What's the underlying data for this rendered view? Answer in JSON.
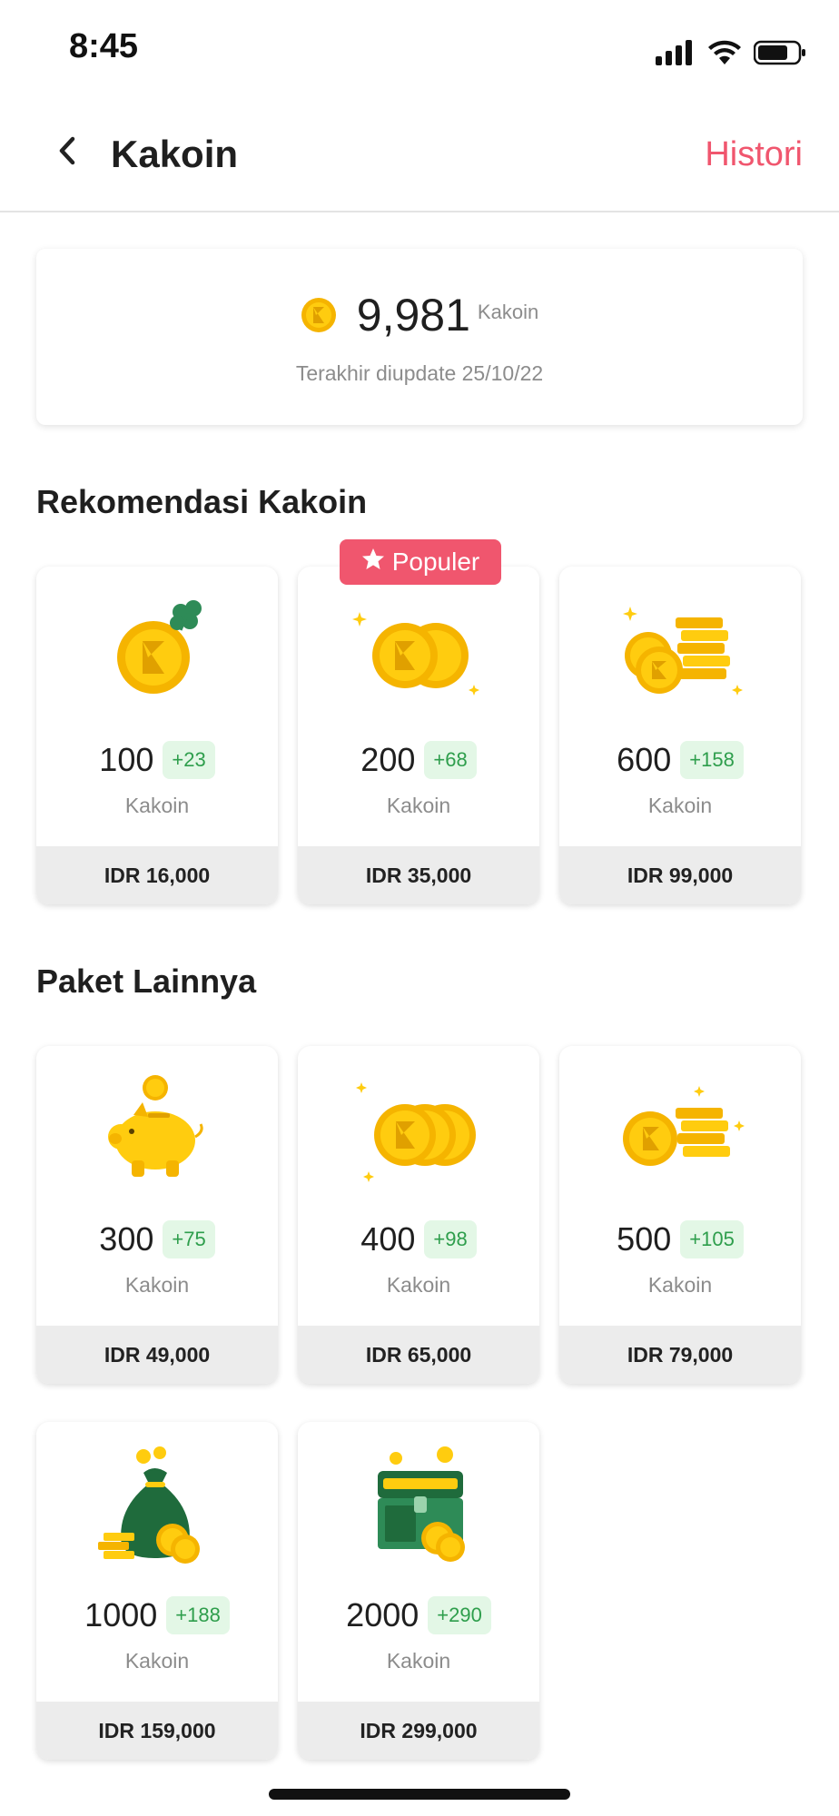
{
  "status_bar": {
    "time": "8:45"
  },
  "header": {
    "title": "Kakoin",
    "histori_label": "Histori"
  },
  "balance": {
    "amount": "9,981",
    "unit": "Kakoin",
    "updated_text": "Terakhir diupdate 25/10/22"
  },
  "sections": {
    "recommended_title": "Rekomendasi Kakoin",
    "others_title": "Paket Lainnya"
  },
  "badge": {
    "populer": "Populer"
  },
  "packages": [
    {
      "amount": "100",
      "bonus": "+23",
      "unit": "Kakoin",
      "price": "IDR 16,000"
    },
    {
      "amount": "200",
      "bonus": "+68",
      "unit": "Kakoin",
      "price": "IDR 35,000"
    },
    {
      "amount": "600",
      "bonus": "+158",
      "unit": "Kakoin",
      "price": "IDR 99,000"
    },
    {
      "amount": "300",
      "bonus": "+75",
      "unit": "Kakoin",
      "price": "IDR 49,000"
    },
    {
      "amount": "400",
      "bonus": "+98",
      "unit": "Kakoin",
      "price": "IDR 65,000"
    },
    {
      "amount": "500",
      "bonus": "+105",
      "unit": "Kakoin",
      "price": "IDR 79,000"
    },
    {
      "amount": "1000",
      "bonus": "+188",
      "unit": "Kakoin",
      "price": "IDR 159,000"
    },
    {
      "amount": "2000",
      "bonus": "+290",
      "unit": "Kakoin",
      "price": "IDR 299,000"
    }
  ],
  "colors": {
    "accent": "#f0566e",
    "coin": "#ffcc0f",
    "coin_dark": "#f5b400",
    "bonus_bg": "#e3f7e6",
    "bonus_text": "#2e9e4c",
    "price_bg": "#ececec"
  },
  "icons": {
    "back": "chevron-left-icon",
    "coin": "kakoin-coin-icon",
    "star": "star-icon"
  }
}
